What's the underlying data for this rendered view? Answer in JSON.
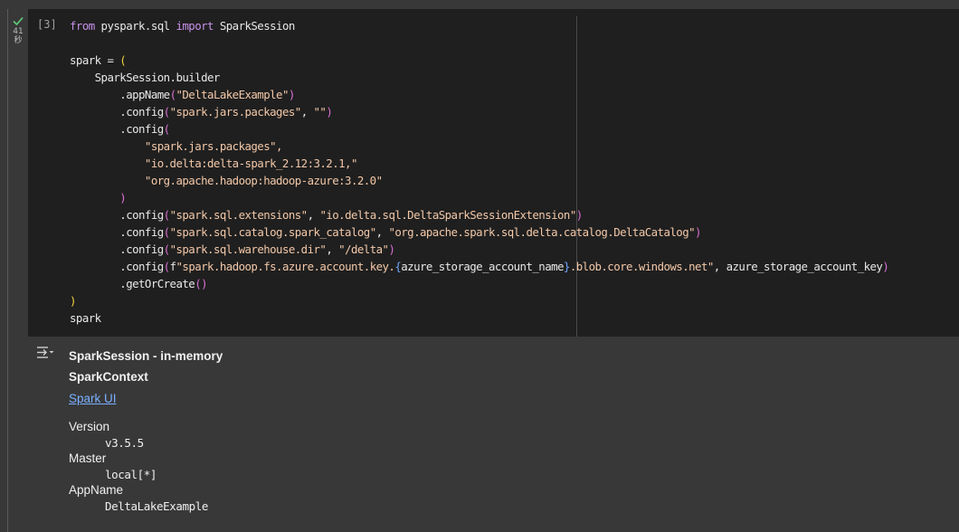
{
  "cell": {
    "run_status": {
      "icon": "check-icon",
      "time_value": "41",
      "time_unit": "秒"
    },
    "execution_count": "[3]",
    "code": {
      "l1_from": "from",
      "l1_module": " pyspark.sql ",
      "l1_import": "import",
      "l1_name": " SparkSession",
      "l3": "spark = ",
      "l3_paren": "(",
      "l4": "    SparkSession.builder",
      "l5_pre": "        .appName",
      "l5_open": "(",
      "l5_str": "\"DeltaLakeExample\"",
      "l5_close": ")",
      "l6_pre": "        .config",
      "l6_open": "(",
      "l6_str1": "\"spark.jars.packages\"",
      "l6_sep": ", ",
      "l6_str2": "\"\"",
      "l6_close": ")",
      "l7_pre": "        .config",
      "l7_open": "(",
      "l8": "            \"spark.jars.packages\",",
      "l9": "            \"io.delta:delta-spark_2.12:3.2.1,\"",
      "l10": "            \"org.apache.hadoop:hadoop-azure:3.2.0\"",
      "l11_indent": "        ",
      "l11_close": ")",
      "l12_pre": "        .config",
      "l12_open": "(",
      "l12_str1": "\"spark.sql.extensions\"",
      "l12_sep": ", ",
      "l12_str2": "\"io.delta.sql.DeltaSparkSessionExtension\"",
      "l12_close": ")",
      "l13_pre": "        .config",
      "l13_open": "(",
      "l13_str1": "\"spark.sql.catalog.spark_catalog\"",
      "l13_sep": ", ",
      "l13_str2": "\"org.apache.spark.sql.delta.catalog.DeltaCatalog\"",
      "l13_close": ")",
      "l14_pre": "        .config",
      "l14_open": "(",
      "l14_str1": "\"spark.sql.warehouse.dir\"",
      "l14_sep": ", ",
      "l14_str2": "\"/delta\"",
      "l14_close": ")",
      "l15_pre": "        .config",
      "l15_open": "(",
      "l15_f": "f",
      "l15_str1": "\"spark.hadoop.fs.azure.account.key.",
      "l15_brace_open": "{",
      "l15_var": "azure_storage_account_name",
      "l15_brace_close": "}",
      "l15_str2": ".blob.core.windows.net\"",
      "l15_rest": ", azure_storage_account_key",
      "l15_close": ")",
      "l16_pre": "        .getOrCreate",
      "l16_parens": "()",
      "l17": ")",
      "l18": "spark"
    }
  },
  "output": {
    "icon": "output-toggle-icon",
    "title": "SparkSession - in-memory",
    "context_heading": "SparkContext",
    "link": "Spark UI",
    "properties": [
      {
        "label": "Version",
        "value": "v3.5.5"
      },
      {
        "label": "Master",
        "value": "local[*]"
      },
      {
        "label": "AppName",
        "value": "DeltaLakeExample"
      }
    ]
  }
}
